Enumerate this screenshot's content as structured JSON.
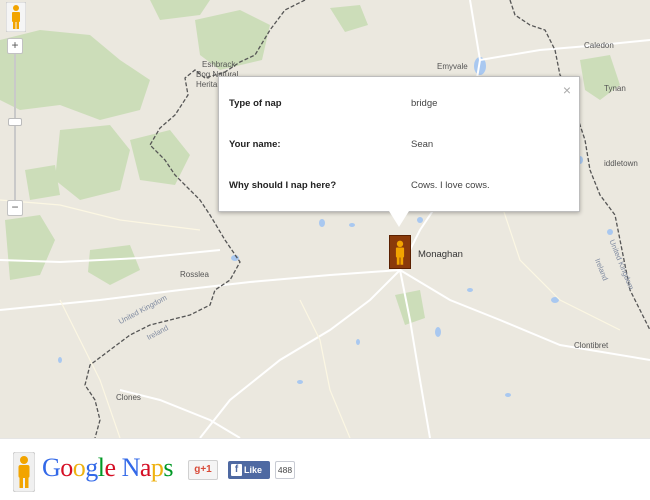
{
  "map": {
    "places": [
      {
        "name": "Eshbrack",
        "cls": "place"
      },
      {
        "name": "Bog Natural",
        "cls": "place"
      },
      {
        "name": "Herita",
        "cls": "place"
      },
      {
        "name": "Emyvale",
        "cls": "place"
      },
      {
        "name": "Caledon",
        "cls": "place"
      },
      {
        "name": "Tynan",
        "cls": "place"
      },
      {
        "name": "iddletown",
        "cls": "place"
      },
      {
        "name": "Rosslea",
        "cls": "place"
      },
      {
        "name": "Clontibret",
        "cls": "place"
      },
      {
        "name": "Clones",
        "cls": "place"
      }
    ],
    "border_labels": {
      "uk_left": "United Kingdom",
      "ireland_left": "Ireland",
      "uk_right": "United Kingdom",
      "ireland_right": "Ireland"
    },
    "marker_label": "Monaghan",
    "colors": {
      "land": "#ebe8df",
      "forest": "#c9dcb5",
      "water": "#a9c8f0",
      "road": "#ffffff",
      "border": "#555555",
      "marker": "#8a3a0a"
    }
  },
  "zoom": {
    "plus": "+",
    "minus": "−"
  },
  "info_window": {
    "close": "×",
    "rows": [
      {
        "label": "Type of nap",
        "value": "bridge"
      },
      {
        "label": "Your name:",
        "value": "Sean"
      },
      {
        "label": "Why should I nap here?",
        "value": "Cows. I love cows."
      }
    ]
  },
  "footer": {
    "logo": {
      "letters": [
        {
          "ch": "G",
          "color": "#3369e8"
        },
        {
          "ch": "o",
          "color": "#d50f25"
        },
        {
          "ch": "o",
          "color": "#eeb211"
        },
        {
          "ch": "g",
          "color": "#3369e8"
        },
        {
          "ch": "l",
          "color": "#009925"
        },
        {
          "ch": "e",
          "color": "#d50f25"
        },
        {
          "ch": " ",
          "color": "#000000"
        },
        {
          "ch": "N",
          "color": "#3369e8"
        },
        {
          "ch": "a",
          "color": "#d50f25"
        },
        {
          "ch": "p",
          "color": "#eeb211"
        },
        {
          "ch": "s",
          "color": "#009925"
        }
      ]
    },
    "gplus_label": "g+1",
    "fb_icon": "f",
    "fb_like_label": "Like",
    "fb_count": "488"
  }
}
